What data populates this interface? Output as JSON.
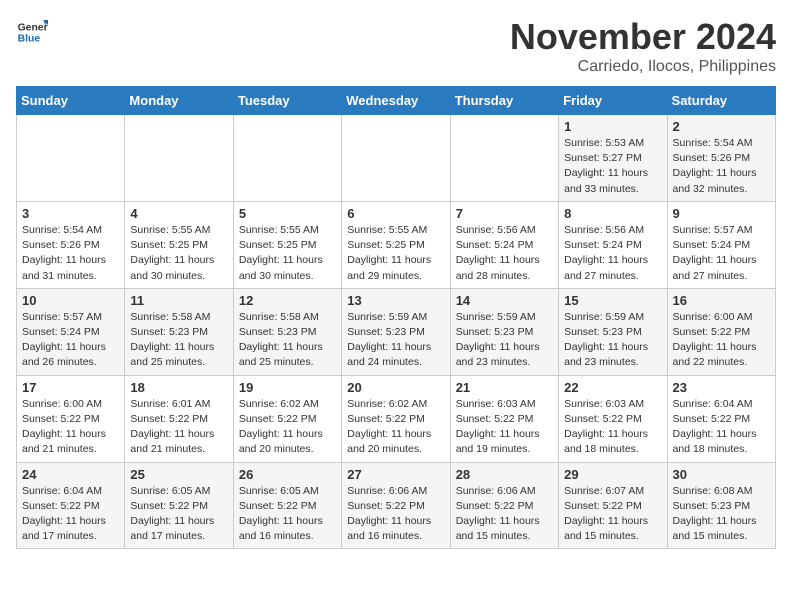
{
  "header": {
    "logo_line1": "General",
    "logo_line2": "Blue",
    "month": "November 2024",
    "location": "Carriedo, Ilocos, Philippines"
  },
  "weekdays": [
    "Sunday",
    "Monday",
    "Tuesday",
    "Wednesday",
    "Thursday",
    "Friday",
    "Saturday"
  ],
  "weeks": [
    [
      {
        "day": "",
        "info": ""
      },
      {
        "day": "",
        "info": ""
      },
      {
        "day": "",
        "info": ""
      },
      {
        "day": "",
        "info": ""
      },
      {
        "day": "",
        "info": ""
      },
      {
        "day": "1",
        "info": "Sunrise: 5:53 AM\nSunset: 5:27 PM\nDaylight: 11 hours\nand 33 minutes."
      },
      {
        "day": "2",
        "info": "Sunrise: 5:54 AM\nSunset: 5:26 PM\nDaylight: 11 hours\nand 32 minutes."
      }
    ],
    [
      {
        "day": "3",
        "info": "Sunrise: 5:54 AM\nSunset: 5:26 PM\nDaylight: 11 hours\nand 31 minutes."
      },
      {
        "day": "4",
        "info": "Sunrise: 5:55 AM\nSunset: 5:25 PM\nDaylight: 11 hours\nand 30 minutes."
      },
      {
        "day": "5",
        "info": "Sunrise: 5:55 AM\nSunset: 5:25 PM\nDaylight: 11 hours\nand 30 minutes."
      },
      {
        "day": "6",
        "info": "Sunrise: 5:55 AM\nSunset: 5:25 PM\nDaylight: 11 hours\nand 29 minutes."
      },
      {
        "day": "7",
        "info": "Sunrise: 5:56 AM\nSunset: 5:24 PM\nDaylight: 11 hours\nand 28 minutes."
      },
      {
        "day": "8",
        "info": "Sunrise: 5:56 AM\nSunset: 5:24 PM\nDaylight: 11 hours\nand 27 minutes."
      },
      {
        "day": "9",
        "info": "Sunrise: 5:57 AM\nSunset: 5:24 PM\nDaylight: 11 hours\nand 27 minutes."
      }
    ],
    [
      {
        "day": "10",
        "info": "Sunrise: 5:57 AM\nSunset: 5:24 PM\nDaylight: 11 hours\nand 26 minutes."
      },
      {
        "day": "11",
        "info": "Sunrise: 5:58 AM\nSunset: 5:23 PM\nDaylight: 11 hours\nand 25 minutes."
      },
      {
        "day": "12",
        "info": "Sunrise: 5:58 AM\nSunset: 5:23 PM\nDaylight: 11 hours\nand 25 minutes."
      },
      {
        "day": "13",
        "info": "Sunrise: 5:59 AM\nSunset: 5:23 PM\nDaylight: 11 hours\nand 24 minutes."
      },
      {
        "day": "14",
        "info": "Sunrise: 5:59 AM\nSunset: 5:23 PM\nDaylight: 11 hours\nand 23 minutes."
      },
      {
        "day": "15",
        "info": "Sunrise: 5:59 AM\nSunset: 5:23 PM\nDaylight: 11 hours\nand 23 minutes."
      },
      {
        "day": "16",
        "info": "Sunrise: 6:00 AM\nSunset: 5:22 PM\nDaylight: 11 hours\nand 22 minutes."
      }
    ],
    [
      {
        "day": "17",
        "info": "Sunrise: 6:00 AM\nSunset: 5:22 PM\nDaylight: 11 hours\nand 21 minutes."
      },
      {
        "day": "18",
        "info": "Sunrise: 6:01 AM\nSunset: 5:22 PM\nDaylight: 11 hours\nand 21 minutes."
      },
      {
        "day": "19",
        "info": "Sunrise: 6:02 AM\nSunset: 5:22 PM\nDaylight: 11 hours\nand 20 minutes."
      },
      {
        "day": "20",
        "info": "Sunrise: 6:02 AM\nSunset: 5:22 PM\nDaylight: 11 hours\nand 20 minutes."
      },
      {
        "day": "21",
        "info": "Sunrise: 6:03 AM\nSunset: 5:22 PM\nDaylight: 11 hours\nand 19 minutes."
      },
      {
        "day": "22",
        "info": "Sunrise: 6:03 AM\nSunset: 5:22 PM\nDaylight: 11 hours\nand 18 minutes."
      },
      {
        "day": "23",
        "info": "Sunrise: 6:04 AM\nSunset: 5:22 PM\nDaylight: 11 hours\nand 18 minutes."
      }
    ],
    [
      {
        "day": "24",
        "info": "Sunrise: 6:04 AM\nSunset: 5:22 PM\nDaylight: 11 hours\nand 17 minutes."
      },
      {
        "day": "25",
        "info": "Sunrise: 6:05 AM\nSunset: 5:22 PM\nDaylight: 11 hours\nand 17 minutes."
      },
      {
        "day": "26",
        "info": "Sunrise: 6:05 AM\nSunset: 5:22 PM\nDaylight: 11 hours\nand 16 minutes."
      },
      {
        "day": "27",
        "info": "Sunrise: 6:06 AM\nSunset: 5:22 PM\nDaylight: 11 hours\nand 16 minutes."
      },
      {
        "day": "28",
        "info": "Sunrise: 6:06 AM\nSunset: 5:22 PM\nDaylight: 11 hours\nand 15 minutes."
      },
      {
        "day": "29",
        "info": "Sunrise: 6:07 AM\nSunset: 5:22 PM\nDaylight: 11 hours\nand 15 minutes."
      },
      {
        "day": "30",
        "info": "Sunrise: 6:08 AM\nSunset: 5:23 PM\nDaylight: 11 hours\nand 15 minutes."
      }
    ]
  ]
}
